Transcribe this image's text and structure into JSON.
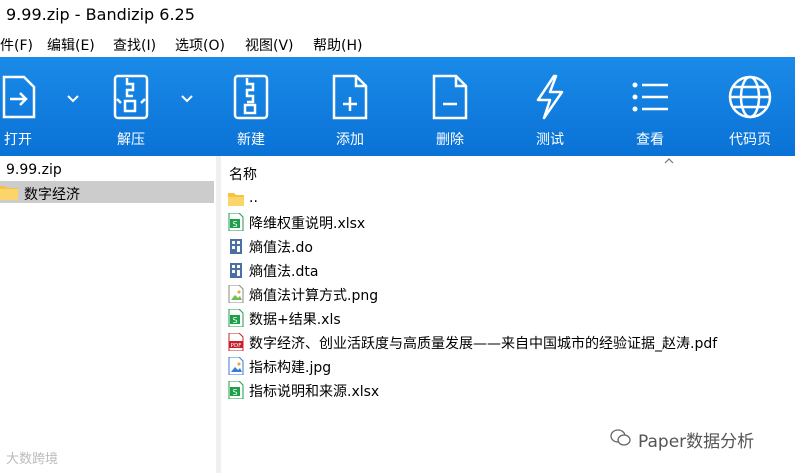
{
  "window": {
    "title": "9.99.zip - Bandizip 6.25"
  },
  "menu": [
    {
      "label": "件(F)"
    },
    {
      "label": "编辑(E)"
    },
    {
      "label": "查找(I)"
    },
    {
      "label": "选项(O)"
    },
    {
      "label": "视图(V)"
    },
    {
      "label": "帮助(H)"
    }
  ],
  "toolbar": {
    "open": "打开",
    "extract": "解压",
    "new": "新建",
    "add": "添加",
    "delete": "删除",
    "test": "测试",
    "view": "查看",
    "codepage": "代码页"
  },
  "tree": {
    "archive": "9.99.zip",
    "folder": "数字经济"
  },
  "files": {
    "header": "名称",
    "rows": [
      {
        "name": "..",
        "icon": "folder-icon"
      },
      {
        "name": "降维权重说明.xlsx",
        "icon": "excel-icon"
      },
      {
        "name": "熵值法.do",
        "icon": "stata-icon"
      },
      {
        "name": "熵值法.dta",
        "icon": "stata-icon"
      },
      {
        "name": "熵值法计算方式.png",
        "icon": "image-icon"
      },
      {
        "name": "数据+结果.xls",
        "icon": "excel-icon"
      },
      {
        "name": "数字经济、创业活跃度与高质量发展——来自中国城市的经验证据_赵涛.pdf",
        "icon": "pdf-icon"
      },
      {
        "name": "指标构建.jpg",
        "icon": "image-icon"
      },
      {
        "name": "指标说明和来源.xlsx",
        "icon": "excel-icon"
      }
    ]
  },
  "watermarks": {
    "left": "大数跨境",
    "right": "Paper数据分析"
  },
  "colors": {
    "toolbar": "#0a72d6",
    "selection": "#cccccc",
    "folder": "#f5c242",
    "excel": "#1e9e4a",
    "pdf": "#c8202a"
  }
}
